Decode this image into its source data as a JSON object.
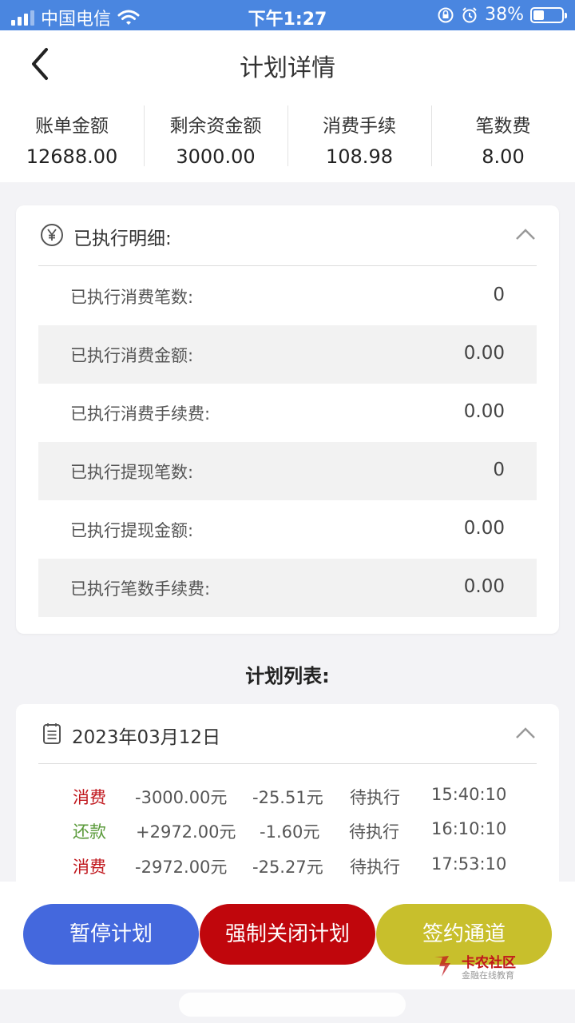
{
  "status_bar": {
    "carrier": "中国电信",
    "time": "下午1:27",
    "battery": "38%",
    "battery_level": 0.38,
    "icons": [
      "signal-icon",
      "wifi-icon",
      "rotation-lock-icon",
      "alarm-icon",
      "battery-icon"
    ]
  },
  "nav": {
    "title": "计划详情",
    "back_icon": "back-chevron-icon"
  },
  "summary": [
    {
      "label": "账单金额",
      "value": "12688.00"
    },
    {
      "label": "剩余资金额",
      "value": "3000.00"
    },
    {
      "label": "消费手续",
      "value": "108.98"
    },
    {
      "label": "笔数费",
      "value": "8.00"
    }
  ],
  "executed": {
    "title": "已执行明细:",
    "icon": "yen-icon",
    "rows": [
      {
        "label": "已执行消费笔数:",
        "value": "0"
      },
      {
        "label": "已执行消费金额:",
        "value": "0.00"
      },
      {
        "label": "已执行消费手续费:",
        "value": "0.00"
      },
      {
        "label": "已执行提现笔数:",
        "value": "0"
      },
      {
        "label": "已执行提现金额:",
        "value": "0.00"
      },
      {
        "label": "已执行笔数手续费:",
        "value": "0.00"
      }
    ]
  },
  "plan_list": {
    "title": "计划列表:",
    "date": "2023年03月12日",
    "icon": "calendar-list-icon",
    "items": [
      {
        "type": "消费",
        "amount": "-3000.00元",
        "fee": "-25.51元",
        "status": "待执行",
        "time": "15:40:10"
      },
      {
        "type": "还款",
        "amount": "+2972.00元",
        "fee": "-1.60元",
        "status": "待执行",
        "time": "16:10:10"
      },
      {
        "type": "消费",
        "amount": "-2972.00元",
        "fee": "-25.27元",
        "status": "待执行",
        "time": "17:53:10"
      }
    ]
  },
  "actions": {
    "pause": "暂停计划",
    "force_close": "强制关闭计划",
    "sign": "签约通道"
  },
  "watermark": {
    "name": "卡农社区",
    "sub": "金融在线教育"
  },
  "colors": {
    "header_blue": "#4a86e0",
    "pause_blue": "#4468dd",
    "close_red": "#c0060c",
    "sign_yellow": "#c8bf2c",
    "consume_red": "#c0161c",
    "repay_green": "#5a9a3a"
  }
}
